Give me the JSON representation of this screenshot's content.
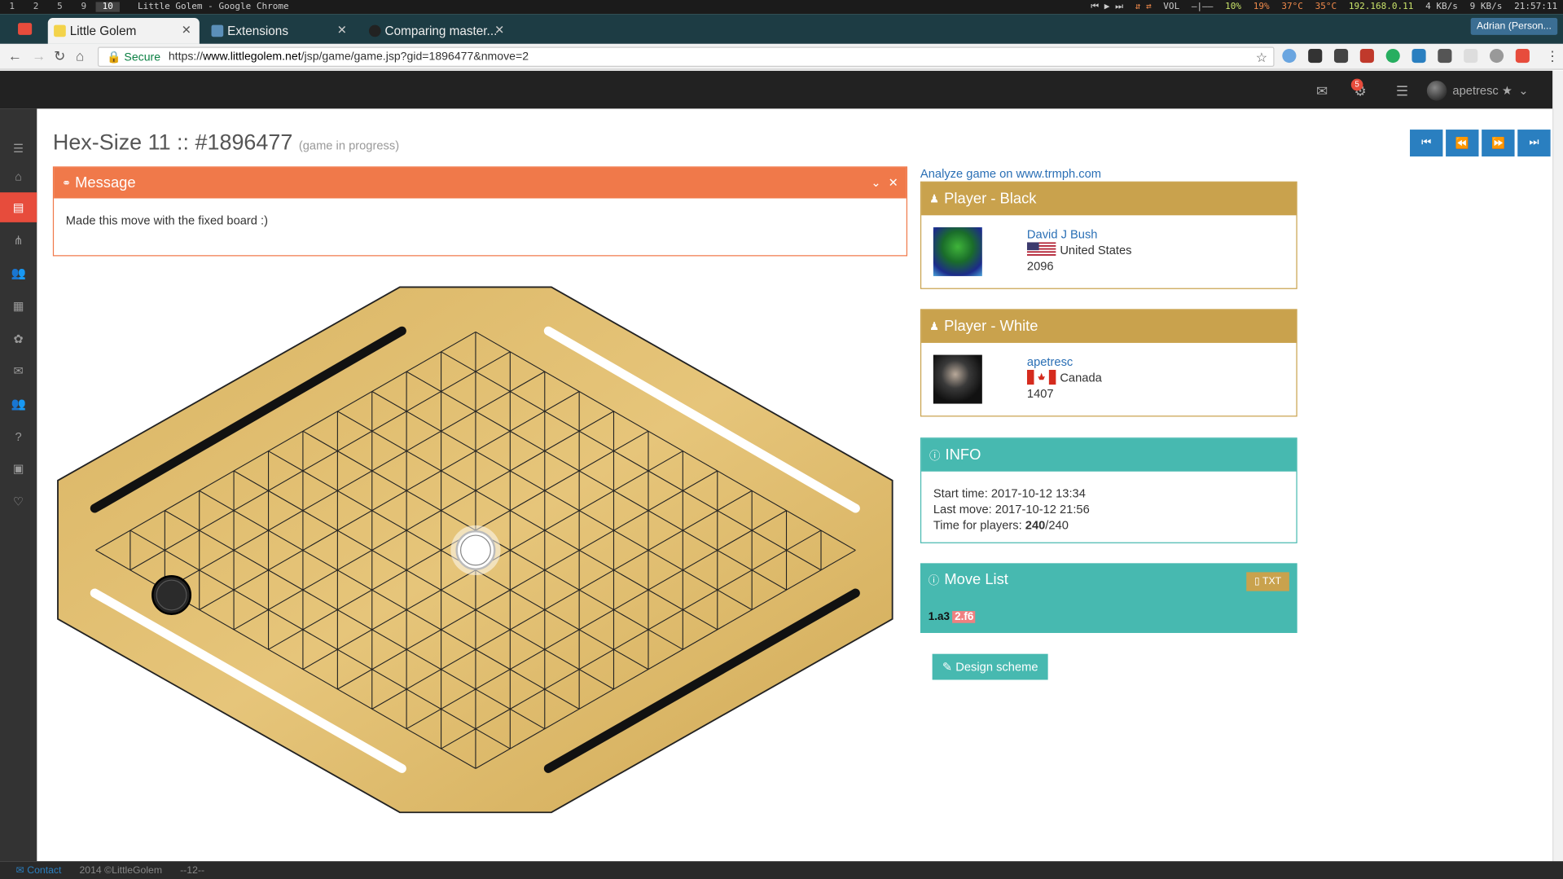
{
  "system_bar": {
    "workspaces": [
      "1",
      "2",
      "5",
      "9",
      "10"
    ],
    "window_title": "Little Golem - Google Chrome",
    "vol": "VOL",
    "cpu": "10%",
    "mem": "19%",
    "temp1": "37°C",
    "temp2": "35°C",
    "ip": "192.168.0.11",
    "down": "4 KB/s",
    "up": "9 KB/s",
    "clock": "21:57:11"
  },
  "browser": {
    "tabs": [
      {
        "label": "Little Golem"
      },
      {
        "label": "Extensions"
      },
      {
        "label": "Comparing master..."
      }
    ],
    "profile": "Adrian (Person...",
    "secure_label": "Secure",
    "url_prefix": "https://",
    "url_host": "www.littlegolem.net",
    "url_path": "/jsp/game/game.jsp?gid=1896477&nmove=2"
  },
  "header": {
    "username": "apetresc ★",
    "notif_count": "5"
  },
  "page": {
    "title": "Hex-Size 11 :: #1896477",
    "status": "(game in progress)"
  },
  "message": {
    "title": "Message",
    "body": "Made this move with the fixed board :)"
  },
  "analyze_link": "Analyze game on www.trmph.com",
  "black": {
    "title": "Player - Black",
    "name": "David J Bush",
    "country": "United States",
    "rating": "2096"
  },
  "white": {
    "title": "Player - White",
    "name": "apetresc",
    "country": "Canada",
    "rating": "1407"
  },
  "info": {
    "title": "INFO",
    "start_label": "Start time: 2017-10-12 13:34",
    "last_label": "Last move: 2017-10-12 21:56",
    "time_label": "Time for players: ",
    "time_bold": "240",
    "time_rest": "/240"
  },
  "movelist": {
    "title": "Move List",
    "txt_button": "TXT",
    "move1": "1.a3",
    "move2": "2.f6"
  },
  "design_button": "Design scheme",
  "footer": {
    "contact": "Contact",
    "copyright": "2014 ©LittleGolem",
    "version": "--12--"
  },
  "colors": {
    "accent_orange": "#f0794a",
    "gold": "#c9a24d",
    "teal": "#47b9b0",
    "blue": "#2a7fc0"
  }
}
